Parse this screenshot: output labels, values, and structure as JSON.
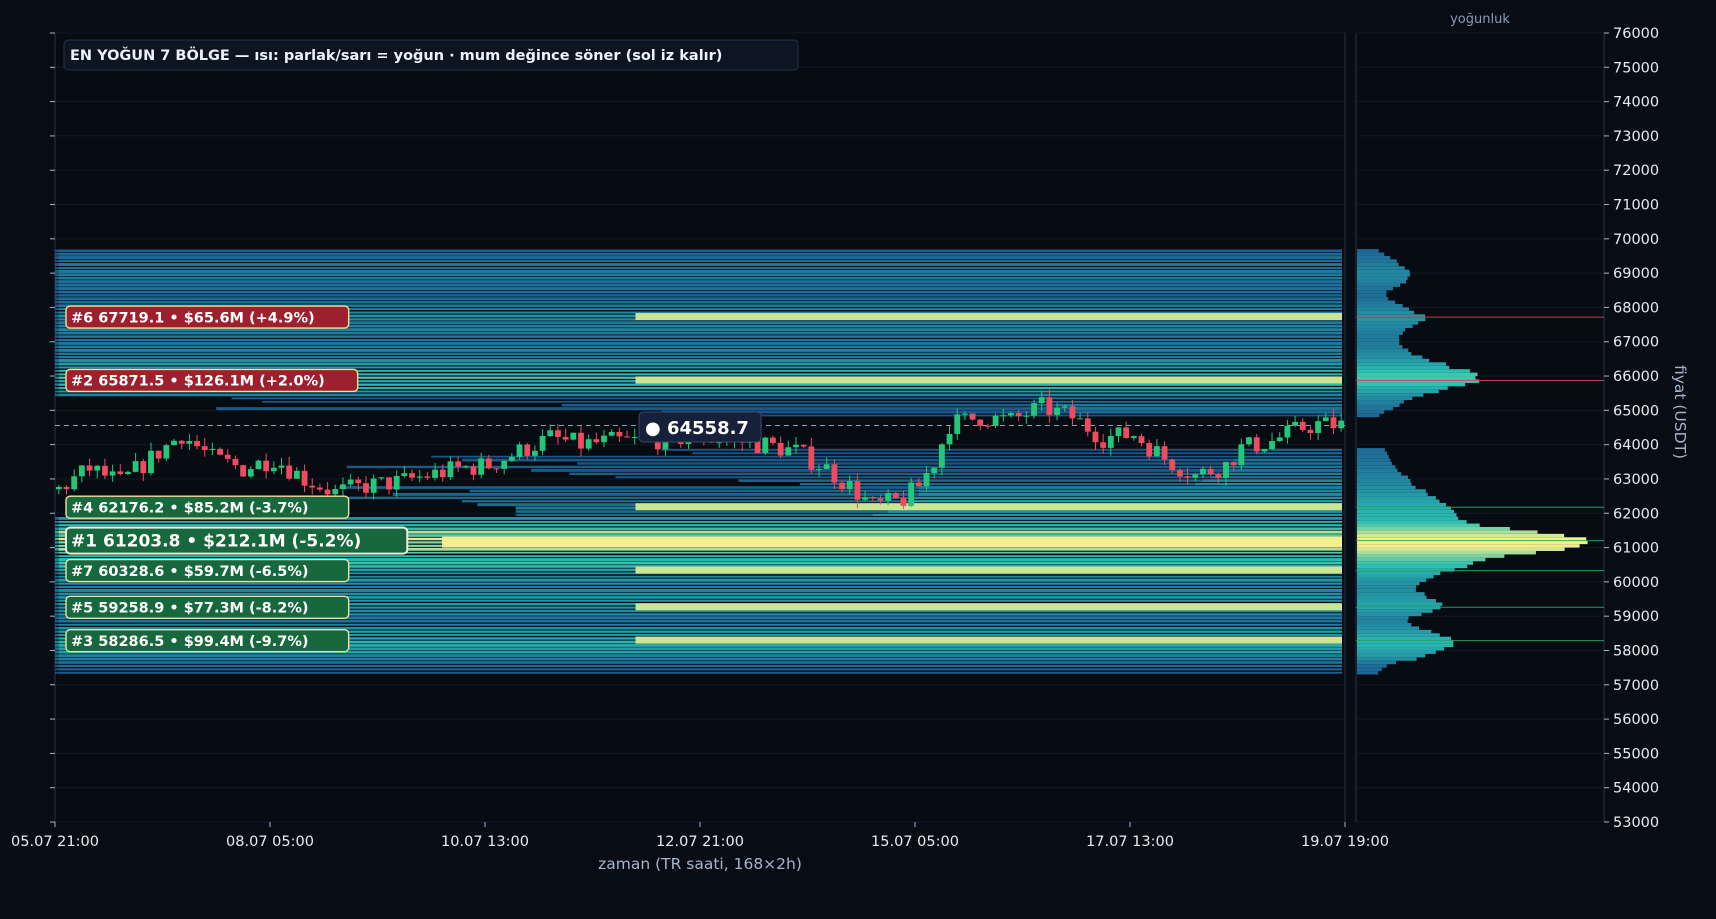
{
  "chart_data": {
    "type": "heatmap",
    "title": "EN YOĞUN 7 BÖLGE — ısı: parlak/sarı = yoğun · mum değince söner (sol iz kalır)",
    "xlabel": "zaman (TR saati, 168×2h)",
    "ylabel": "fiyat (USDT)",
    "profile_title": "yoğunluk",
    "ylim": [
      53000,
      76000
    ],
    "y_ticks": [
      53000,
      54000,
      55000,
      56000,
      57000,
      58000,
      59000,
      60000,
      61000,
      62000,
      63000,
      64000,
      65000,
      66000,
      67000,
      68000,
      69000,
      70000,
      71000,
      72000,
      73000,
      74000,
      75000,
      76000
    ],
    "x_ticks": [
      "05.07 21:00",
      "08.07 05:00",
      "10.07 13:00",
      "12.07 21:00",
      "15.07 05:00",
      "17.07 13:00",
      "19.07 19:00"
    ],
    "candle_count": 168,
    "current_price": {
      "label": "● 64558.7",
      "value": 64558.7
    },
    "zones": [
      {
        "label": "#6  67719.1  •  $65.6M  (+4.9%)",
        "price": 67719.1,
        "side": "above"
      },
      {
        "label": "#2  65871.5  •  $126.1M  (+2.0%)",
        "price": 65871.5,
        "side": "above"
      },
      {
        "label": "#4  62176.2  •  $85.2M  (-3.7%)",
        "price": 62176.2,
        "side": "below"
      },
      {
        "label": "#1  61203.8  •  $212.1M  (-5.2%)",
        "price": 61203.8,
        "side": "below",
        "top": true
      },
      {
        "label": "#7  60328.6  •  $59.7M  (-6.5%)",
        "price": 60328.6,
        "side": "below"
      },
      {
        "label": "#5  59258.9  •  $77.3M  (-8.2%)",
        "price": 59258.9,
        "side": "below"
      },
      {
        "label": "#3  58286.5  •  $99.4M  (-9.7%)",
        "price": 58286.5,
        "side": "below"
      }
    ],
    "price_path": [
      [
        0,
        62700
      ],
      [
        4,
        63300
      ],
      [
        8,
        62900
      ],
      [
        12,
        63600
      ],
      [
        16,
        64300
      ],
      [
        20,
        63600
      ],
      [
        24,
        63300
      ],
      [
        28,
        63600
      ],
      [
        32,
        63000
      ],
      [
        36,
        62600
      ],
      [
        40,
        62800
      ],
      [
        44,
        62900
      ],
      [
        48,
        63100
      ],
      [
        52,
        63300
      ],
      [
        56,
        63400
      ],
      [
        60,
        63800
      ],
      [
        64,
        64200
      ],
      [
        68,
        64000
      ],
      [
        72,
        64100
      ],
      [
        76,
        64100
      ],
      [
        80,
        64200
      ],
      [
        84,
        64200
      ],
      [
        88,
        64100
      ],
      [
        92,
        64000
      ],
      [
        96,
        63800
      ],
      [
        100,
        63300
      ],
      [
        104,
        62600
      ],
      [
        106,
        62200
      ],
      [
        110,
        62400
      ],
      [
        112,
        62800
      ],
      [
        114,
        63500
      ],
      [
        116,
        64600
      ],
      [
        120,
        64800
      ],
      [
        124,
        64700
      ],
      [
        128,
        65100
      ],
      [
        132,
        64800
      ],
      [
        136,
        64200
      ],
      [
        140,
        64300
      ],
      [
        144,
        63600
      ],
      [
        148,
        63100
      ],
      [
        152,
        63400
      ],
      [
        154,
        63900
      ],
      [
        158,
        64100
      ],
      [
        162,
        64500
      ],
      [
        164,
        64600
      ],
      [
        167,
        64558.7
      ]
    ],
    "profile": [
      [
        57300,
        0.08
      ],
      [
        57600,
        0.14
      ],
      [
        57800,
        0.3
      ],
      [
        58000,
        0.36
      ],
      [
        58200,
        0.45
      ],
      [
        58400,
        0.4
      ],
      [
        58600,
        0.3
      ],
      [
        58900,
        0.2
      ],
      [
        59100,
        0.3
      ],
      [
        59300,
        0.38
      ],
      [
        59500,
        0.32
      ],
      [
        59800,
        0.25
      ],
      [
        60000,
        0.3
      ],
      [
        60300,
        0.4
      ],
      [
        60600,
        0.55
      ],
      [
        60800,
        0.72
      ],
      [
        61000,
        0.92
      ],
      [
        61200,
        1.0
      ],
      [
        61400,
        0.85
      ],
      [
        61600,
        0.6
      ],
      [
        61800,
        0.45
      ],
      [
        62100,
        0.42
      ],
      [
        62400,
        0.35
      ],
      [
        62700,
        0.28
      ],
      [
        63000,
        0.22
      ],
      [
        63300,
        0.18
      ],
      [
        63600,
        0.14
      ],
      [
        63900,
        0.12
      ],
      [
        64800,
        0.08
      ],
      [
        65000,
        0.14
      ],
      [
        65300,
        0.22
      ],
      [
        65600,
        0.38
      ],
      [
        65800,
        0.52
      ],
      [
        66000,
        0.55
      ],
      [
        66200,
        0.45
      ],
      [
        66500,
        0.3
      ],
      [
        66800,
        0.2
      ],
      [
        67100,
        0.18
      ],
      [
        67400,
        0.22
      ],
      [
        67700,
        0.3
      ],
      [
        67900,
        0.25
      ],
      [
        68200,
        0.15
      ],
      [
        68400,
        0.12
      ],
      [
        68700,
        0.2
      ],
      [
        69000,
        0.25
      ],
      [
        69300,
        0.18
      ],
      [
        69700,
        0.08
      ]
    ],
    "colors": {
      "background": "#080c14",
      "panel": "#070b12",
      "up": "#22c77a",
      "down": "#ef4a5f",
      "zone_above": "#9e1f2e",
      "zone_below": "#17693d",
      "heat_low": "#1b4f8f",
      "heat_mid": "#2ac0b2",
      "heat_high": "#f4ee8c"
    }
  }
}
